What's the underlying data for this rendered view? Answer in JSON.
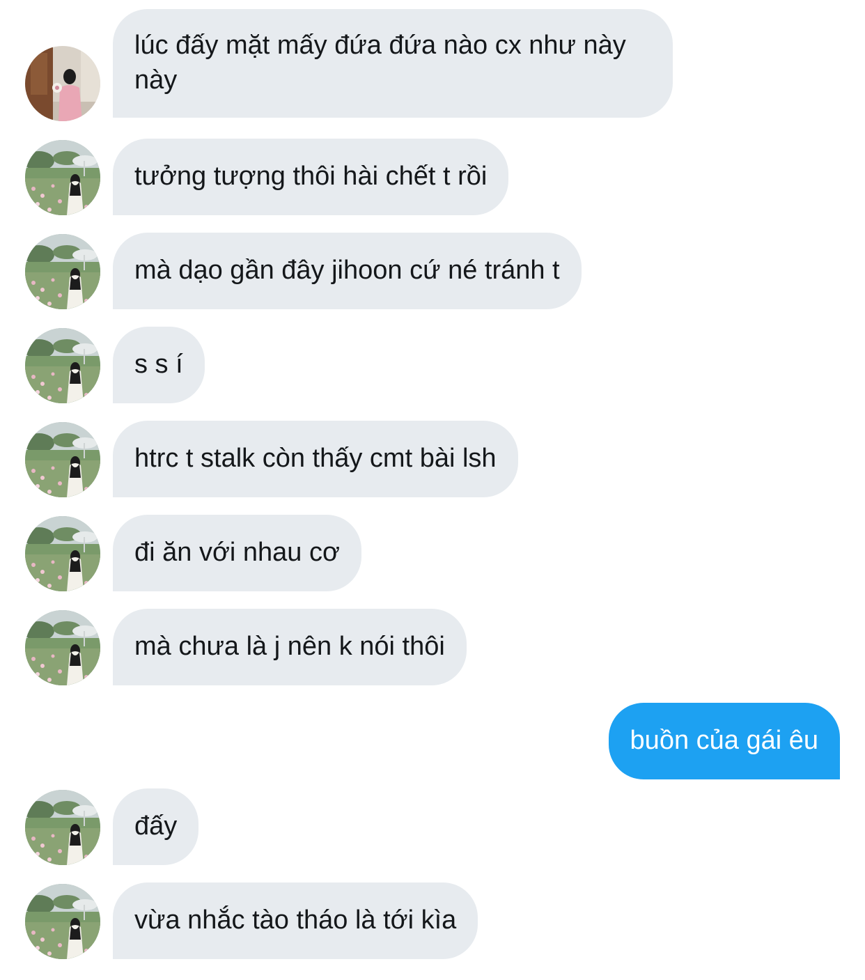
{
  "conversation": {
    "messages": [
      {
        "direction": "incoming",
        "text": "lúc đấy mặt mấy đứa đứa nào cx như này này",
        "avatar": "avatar-pink-outfit"
      },
      {
        "direction": "incoming",
        "text": "tưởng tượng thôi hài chết t rồi",
        "avatar": "avatar-flower-field"
      },
      {
        "direction": "incoming",
        "text": "mà dạo gần đây jihoon cứ né tránh t",
        "avatar": "avatar-flower-field"
      },
      {
        "direction": "incoming",
        "text": "s s í",
        "avatar": "avatar-flower-field"
      },
      {
        "direction": "incoming",
        "text": "htrc t stalk còn thấy cmt bài lsh",
        "avatar": "avatar-flower-field"
      },
      {
        "direction": "incoming",
        "text": "đi ăn với nhau cơ",
        "avatar": "avatar-flower-field"
      },
      {
        "direction": "incoming",
        "text": "mà chưa là j nên k nói thôi",
        "avatar": "avatar-flower-field"
      },
      {
        "direction": "outgoing",
        "text": "buồn của gái êu"
      },
      {
        "direction": "incoming",
        "text": "đấy",
        "avatar": "avatar-flower-field"
      },
      {
        "direction": "incoming",
        "text": "vừa nhắc tào tháo là tới kìa",
        "avatar": "avatar-flower-field"
      }
    ]
  },
  "colors": {
    "incoming_bubble": "#e7ebef",
    "outgoing_bubble": "#1da1f2",
    "incoming_text": "#14171a",
    "outgoing_text": "#ffffff"
  }
}
